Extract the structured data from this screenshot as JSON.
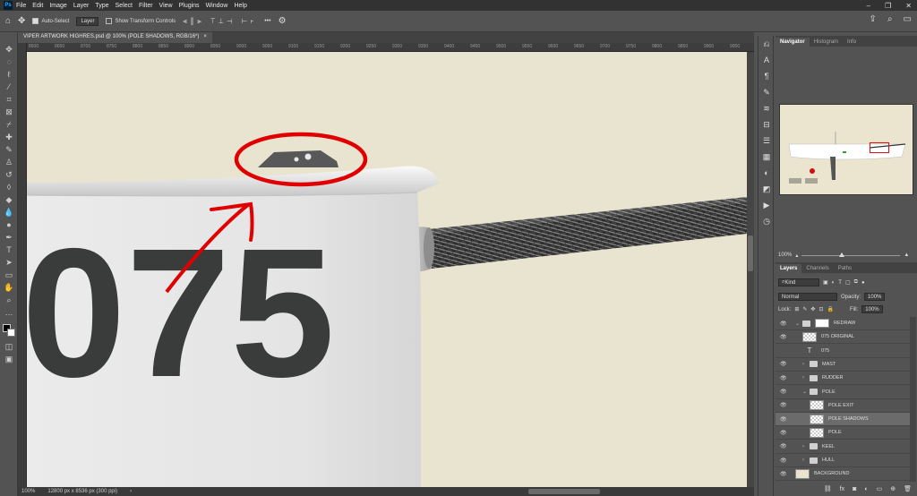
{
  "menu": {
    "items": [
      "File",
      "Edit",
      "Image",
      "Layer",
      "Type",
      "Select",
      "Filter",
      "View",
      "Plugins",
      "Window",
      "Help"
    ]
  },
  "options": {
    "auto_select": "Auto-Select",
    "layer_mode": "Layer",
    "show_transform": "Show Transform Controls",
    "more": "•••"
  },
  "document": {
    "tab_title": "VIPER ARTWORK HIGHRES.psd @ 100% (POLE SHADOWS, RGB/16*)",
    "close": "×"
  },
  "ruler": {
    "ticks": [
      "8600",
      "8650",
      "8700",
      "8750",
      "8800",
      "8850",
      "8900",
      "8950",
      "9000",
      "9050",
      "9100",
      "9150",
      "9200",
      "9250",
      "9300",
      "9350",
      "9400",
      "9450",
      "9500",
      "9550",
      "9600",
      "9650",
      "9700",
      "9750",
      "9800",
      "9850",
      "9900",
      "9950"
    ]
  },
  "canvas": {
    "hull_number": "075",
    "background_color": "#e9e4d0",
    "annotation_color": "#e00000"
  },
  "status": {
    "zoom": "100%",
    "dims": "12800 px x 8536 px (300 ppi)",
    "arrow": "›"
  },
  "navigator": {
    "tabs": [
      "Navigator",
      "Histogram",
      "Info"
    ],
    "zoom": "100%"
  },
  "layers_panel": {
    "tabs": [
      "Layers",
      "Channels",
      "Paths"
    ],
    "kind": "Kind",
    "blend": "Normal",
    "opacity_label": "Opacity:",
    "opacity": "100%",
    "lock_label": "Lock:",
    "fill_label": "Fill:",
    "fill": "100%"
  },
  "layers": [
    {
      "name": "REDRAW",
      "kind": "group-mask",
      "indent": 0,
      "visible": true,
      "expanded": true
    },
    {
      "name": "075 ORIGINAL",
      "kind": "pixel",
      "indent": 1,
      "visible": true
    },
    {
      "name": "075",
      "kind": "text",
      "indent": 1,
      "visible": false
    },
    {
      "name": "MAST",
      "kind": "folder",
      "indent": 1,
      "visible": true,
      "expanded": false
    },
    {
      "name": "RUDDER",
      "kind": "folder",
      "indent": 1,
      "visible": true,
      "expanded": false
    },
    {
      "name": "POLE",
      "kind": "folder",
      "indent": 1,
      "visible": true,
      "expanded": true
    },
    {
      "name": "POLE EXIT",
      "kind": "pixel",
      "indent": 2,
      "visible": true
    },
    {
      "name": "POLE SHADOWS",
      "kind": "pixel",
      "indent": 2,
      "visible": true,
      "selected": true
    },
    {
      "name": "POLE",
      "kind": "pixel",
      "indent": 2,
      "visible": true
    },
    {
      "name": "KEEL",
      "kind": "folder",
      "indent": 1,
      "visible": true,
      "expanded": false
    },
    {
      "name": "HULL",
      "kind": "folder",
      "indent": 1,
      "visible": true,
      "expanded": false
    },
    {
      "name": "BACKGROUND",
      "kind": "fill",
      "indent": 0,
      "visible": true
    }
  ]
}
